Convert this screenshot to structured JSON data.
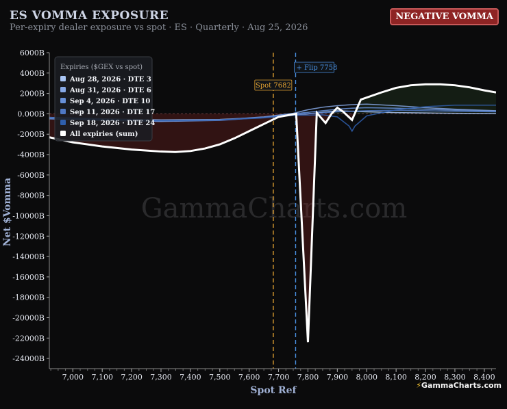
{
  "header": {
    "title": "ES VOMMA EXPOSURE",
    "subtitle": "Per-expiry dealer exposure vs spot · ES · Quarterly · Aug 25, 2026",
    "badge": "NEGATIVE VOMMA"
  },
  "brand": {
    "bolt": "⚡",
    "text": "GammaCharts.com"
  },
  "watermark": "GammaCharts.com",
  "chart_data": {
    "type": "line",
    "xlabel": "Spot Ref",
    "ylabel": "Net $Vomma",
    "xlim": [
      6920,
      8440
    ],
    "ylim": [
      -25000,
      6000
    ],
    "x_ticks": [
      7000,
      7100,
      7200,
      7300,
      7400,
      7500,
      7600,
      7700,
      7800,
      7900,
      8000,
      8100,
      8200,
      8300,
      8400
    ],
    "x_tick_labels": [
      "7,000",
      "7,100",
      "7,200",
      "7,300",
      "7,400",
      "7,500",
      "7,600",
      "7,700",
      "7,800",
      "7,900",
      "8,000",
      "8,100",
      "8,200",
      "8,300",
      "8,400"
    ],
    "y_ticks": [
      6000,
      4000,
      2000,
      0,
      -2000,
      -4000,
      -6000,
      -8000,
      -10000,
      -12000,
      -14000,
      -16000,
      -18000,
      -20000,
      -22000,
      -24000
    ],
    "y_tick_labels": [
      "6000B",
      "4000B",
      "2000B",
      "0.000B",
      "-2000B",
      "-4000B",
      "-6000B",
      "-8000B",
      "-10000B",
      "-12000B",
      "-14000B",
      "-16000B",
      "-18000B",
      "-20000B",
      "-22000B",
      "-24000B"
    ],
    "grid": false,
    "legend": {
      "title": "Expiries ($GEX vs spot)",
      "placement": "top-left"
    },
    "markers": [
      {
        "label": "Spot 7682",
        "x": 7682,
        "color": "#e0a030"
      },
      {
        "label": "+ Flip 7758",
        "x": 7758,
        "color": "#4a90e2"
      }
    ],
    "series": [
      {
        "name": "Aug 28, 2026 · DTE 3",
        "color": "#a9c6f5",
        "x": [
          6920,
          7100,
          7300,
          7500,
          7650,
          7750,
          7800,
          7850,
          7900,
          7950,
          8000,
          8100,
          8200,
          8300,
          8440
        ],
        "values": [
          -350,
          -500,
          -600,
          -550,
          -350,
          -100,
          0,
          150,
          300,
          250,
          200,
          120,
          80,
          50,
          20
        ]
      },
      {
        "name": "Aug 31, 2026 · DTE 6",
        "color": "#86a8e6",
        "x": [
          6920,
          7100,
          7300,
          7500,
          7650,
          7750,
          7800,
          7850,
          7900,
          7950,
          8000,
          8100,
          8200,
          8300,
          8440
        ],
        "values": [
          -450,
          -600,
          -700,
          -600,
          -300,
          50,
          400,
          650,
          800,
          900,
          950,
          800,
          600,
          450,
          300
        ]
      },
      {
        "name": "Sep 4, 2026 · DTE 10",
        "color": "#6790d8",
        "x": [
          6920,
          7100,
          7300,
          7500,
          7650,
          7750,
          7850,
          7900,
          7950,
          8000,
          8100,
          8200,
          8300,
          8440
        ],
        "values": [
          -500,
          -650,
          -750,
          -650,
          -350,
          0,
          300,
          450,
          550,
          600,
          550,
          450,
          350,
          250
        ]
      },
      {
        "name": "Sep 11, 2026 · DTE 17",
        "color": "#4f78c4",
        "x": [
          6920,
          7100,
          7300,
          7500,
          7650,
          7750,
          7850,
          7900,
          7950,
          8000,
          8100,
          8200,
          8300,
          8440
        ],
        "values": [
          -350,
          -500,
          -650,
          -600,
          -350,
          -50,
          100,
          200,
          250,
          300,
          350,
          300,
          250,
          200
        ]
      },
      {
        "name": "Sep 18, 2026 · DTE 24",
        "color": "#2f5fae",
        "x": [
          6920,
          7100,
          7300,
          7500,
          7650,
          7750,
          7850,
          7900,
          7940,
          7950,
          7960,
          8000,
          8100,
          8200,
          8300,
          8440
        ],
        "values": [
          -400,
          -550,
          -650,
          -600,
          -400,
          -150,
          -100,
          -300,
          -1200,
          -1700,
          -1200,
          -200,
          400,
          700,
          850,
          850
        ]
      },
      {
        "name": "All expiries (sum)",
        "color": "#ffffff",
        "x": [
          6920,
          7000,
          7100,
          7200,
          7300,
          7350,
          7400,
          7450,
          7500,
          7550,
          7600,
          7650,
          7700,
          7760,
          7800,
          7830,
          7860,
          7880,
          7900,
          7920,
          7950,
          7980,
          8050,
          8100,
          8150,
          8200,
          8250,
          8300,
          8350,
          8400,
          8440
        ],
        "values": [
          -2300,
          -2800,
          -3200,
          -3500,
          -3700,
          -3750,
          -3650,
          -3400,
          -3000,
          -2400,
          -1700,
          -1000,
          -300,
          0,
          -22400,
          100,
          -900,
          0,
          600,
          200,
          -600,
          1400,
          2100,
          2550,
          2800,
          2900,
          2900,
          2800,
          2600,
          2300,
          2100
        ]
      }
    ]
  }
}
